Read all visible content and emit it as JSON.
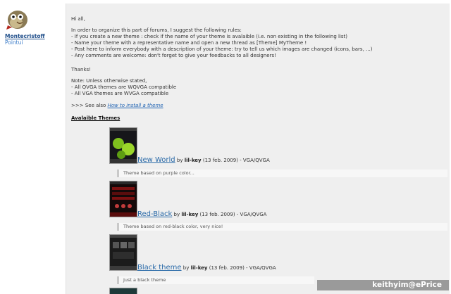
{
  "user": {
    "name": "Montecristoff",
    "title": "Pointui"
  },
  "post": {
    "greeting": "Hi all,",
    "intro": "In order to organize this part of forums, I suggest the following rules:",
    "rules": [
      "- If you create a new theme : check if the name of your theme is avalaible (i.e. non existing in the following list)",
      "- Name your theme with a representative name and open a new thread as [Theme] MyTheme !",
      "- Post here to inform everybody with a description of your theme: try to tell us which images are changed (icons, bars, ...)",
      "- Any comments are welcome: don't forget to give your feedbacks to all designers!"
    ],
    "thanks": "Thanks!",
    "note_title": "Note: Unless otherwise stated,",
    "notes": [
      "- All QVGA themes are WQVGA compatible",
      "- All VGA themes are WVGA compatible"
    ],
    "see_also_prefix": ">>> See also",
    "see_also_link": "How to install a theme",
    "heading": "Avalaible Themes"
  },
  "themes": [
    {
      "name": "New World",
      "by": "by",
      "author": "lil-key",
      "meta": "(13 feb. 2009) - VGA/QVGA",
      "description": "Theme based on purple color..."
    },
    {
      "name": "Red-Black",
      "by": "by",
      "author": "lil-key",
      "meta": "(13 feb. 2009) - VGA/QVGA",
      "description": "Theme based on red-black color, very nice!"
    },
    {
      "name": "Black theme",
      "by": "by",
      "author": "lil-key",
      "meta": "(13 feb. 2009) - VGA/QVGA",
      "description": "Just a black theme"
    }
  ],
  "watermark": "keithyim@ePrice"
}
